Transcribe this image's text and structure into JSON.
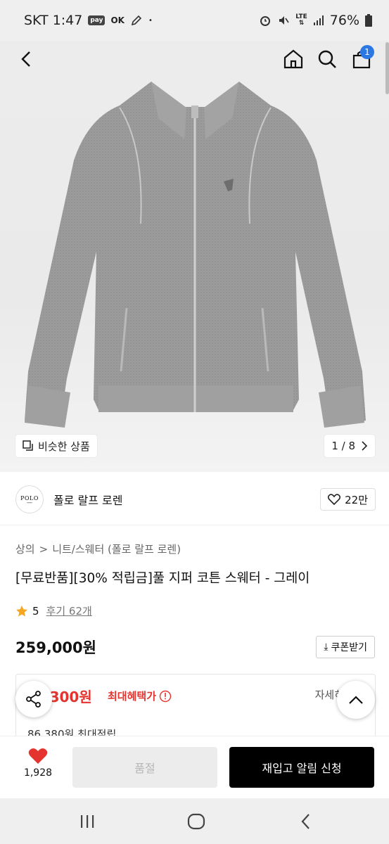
{
  "status_bar": {
    "carrier_time": "SKT 1:47",
    "pay_badge": "pay",
    "ok_badge": "OK",
    "dot": "•",
    "network": "LTE",
    "battery": "76%"
  },
  "top_nav": {
    "back_icon": "chevron-left-icon",
    "home_icon": "home-icon",
    "search_icon": "search-icon",
    "cart_icon": "shopping-bag-icon",
    "cart_count": "1"
  },
  "gallery": {
    "similar_label": "비슷한 상품",
    "page_indicator": "1 / 8"
  },
  "brand": {
    "logo_text": "POLO",
    "name": "폴로 랄프 로렌",
    "likes": "22만"
  },
  "breadcrumb": {
    "category": "상의",
    "separator": ">",
    "subcategory": "니트/스웨터 (폴로 랄프 로렌)"
  },
  "product": {
    "title": "[무료반품][30% 적립금]풀 지퍼 코튼 스웨터 - 그레이",
    "rating": "5",
    "reviews": "후기 62개",
    "price": "259,000원",
    "coupon_label": "쿠폰받기"
  },
  "benefit": {
    "max_benefit_amount": ",300원",
    "max_benefit_label": "최대혜택가",
    "detail_label": "자세히",
    "points": "86,380원 최대적립"
  },
  "action_bar": {
    "wish_count": "1,928",
    "soldout_label": "품절",
    "restock_label": "재입고 알림 신청"
  },
  "colors": {
    "accent_red": "#e3342f",
    "badge_blue": "#2b78e4",
    "star": "#f5a623"
  }
}
